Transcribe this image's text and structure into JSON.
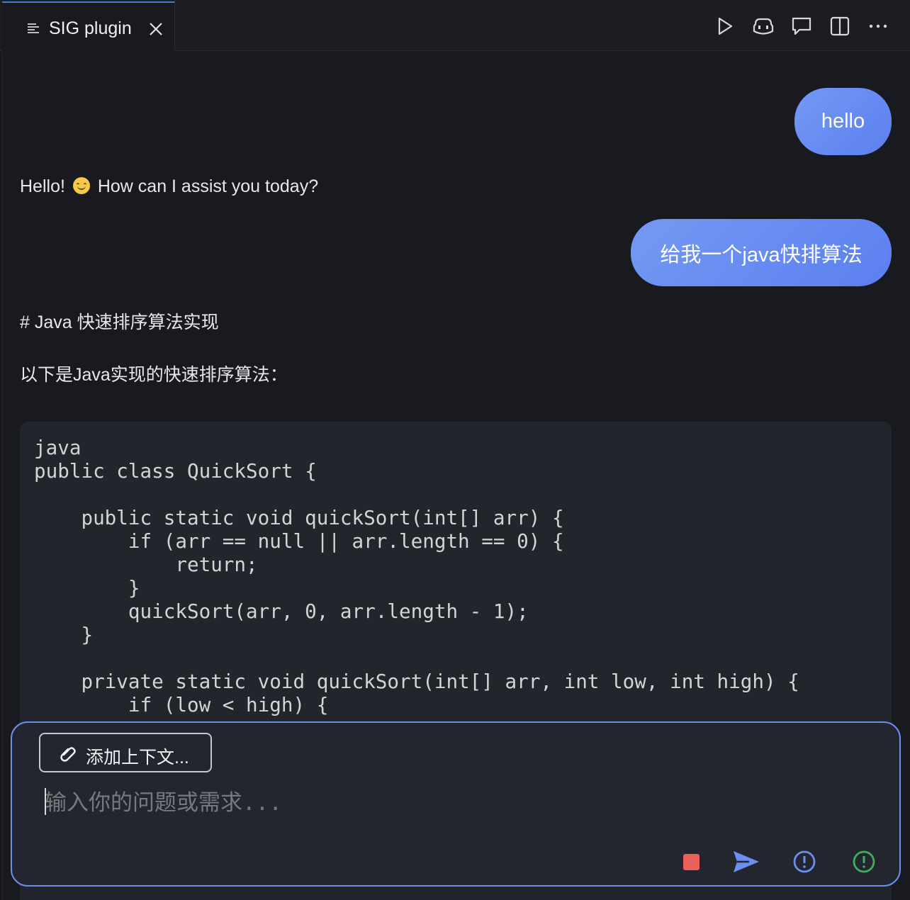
{
  "tab": {
    "title": "SIG plugin"
  },
  "messages": {
    "user1": "hello",
    "assistant1_before": "Hello!",
    "assistant1_after": "How can I assist you today?",
    "user2": "给我一个java快排算法",
    "heading": "# Java 快速排序算法实现",
    "intro": "以下是Java实现的快速排序算法："
  },
  "code": "java\npublic class QuickSort {\n\n    public static void quickSort(int[] arr) {\n        if (arr == null || arr.length == 0) {\n            return;\n        }\n        quickSort(arr, 0, arr.length - 1);\n    }\n\n    private static void quickSort(int[] arr, int low, int high) {\n        if (low < high) {",
  "input": {
    "context_button": "添加上下文...",
    "placeholder": "输入你的问题或需求..."
  },
  "colors": {
    "accent": "#5b7ff0",
    "stop": "#e8615b",
    "info": "#6b8ff0",
    "ok": "#3fae5a"
  },
  "icons": [
    "list-icon",
    "close-icon",
    "run-icon",
    "copilot-icon",
    "comment-icon",
    "split-editor-icon",
    "more-icon",
    "paperclip-icon",
    "stop-icon",
    "send-icon",
    "info-icon",
    "info-green-icon"
  ]
}
